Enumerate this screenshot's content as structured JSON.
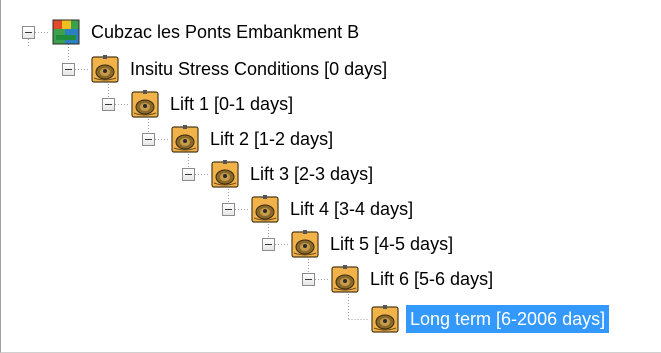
{
  "tree": {
    "root": {
      "label": "Cubzac les Ponts Embankment B",
      "icon": "project-icon"
    },
    "stages": [
      {
        "label": "Insitu Stress Conditions [0 days]",
        "icon": "stage-icon"
      },
      {
        "label": "Lift 1 [0-1 days]",
        "icon": "stage-icon"
      },
      {
        "label": "Lift 2 [1-2 days]",
        "icon": "stage-icon"
      },
      {
        "label": "Lift 3 [2-3 days]",
        "icon": "stage-icon"
      },
      {
        "label": "Lift 4 [3-4 days]",
        "icon": "stage-icon"
      },
      {
        "label": "Lift 5 [4-5 days]",
        "icon": "stage-icon"
      },
      {
        "label": "Lift 6 [5-6 days]",
        "icon": "stage-icon"
      },
      {
        "label": "Long term [6-2006 days]",
        "icon": "stage-icon",
        "selected": true
      }
    ],
    "colors": {
      "selection": "#3399ff",
      "connector": "#a0a0a0",
      "stage_icon_fill": "#e8a33a"
    }
  }
}
